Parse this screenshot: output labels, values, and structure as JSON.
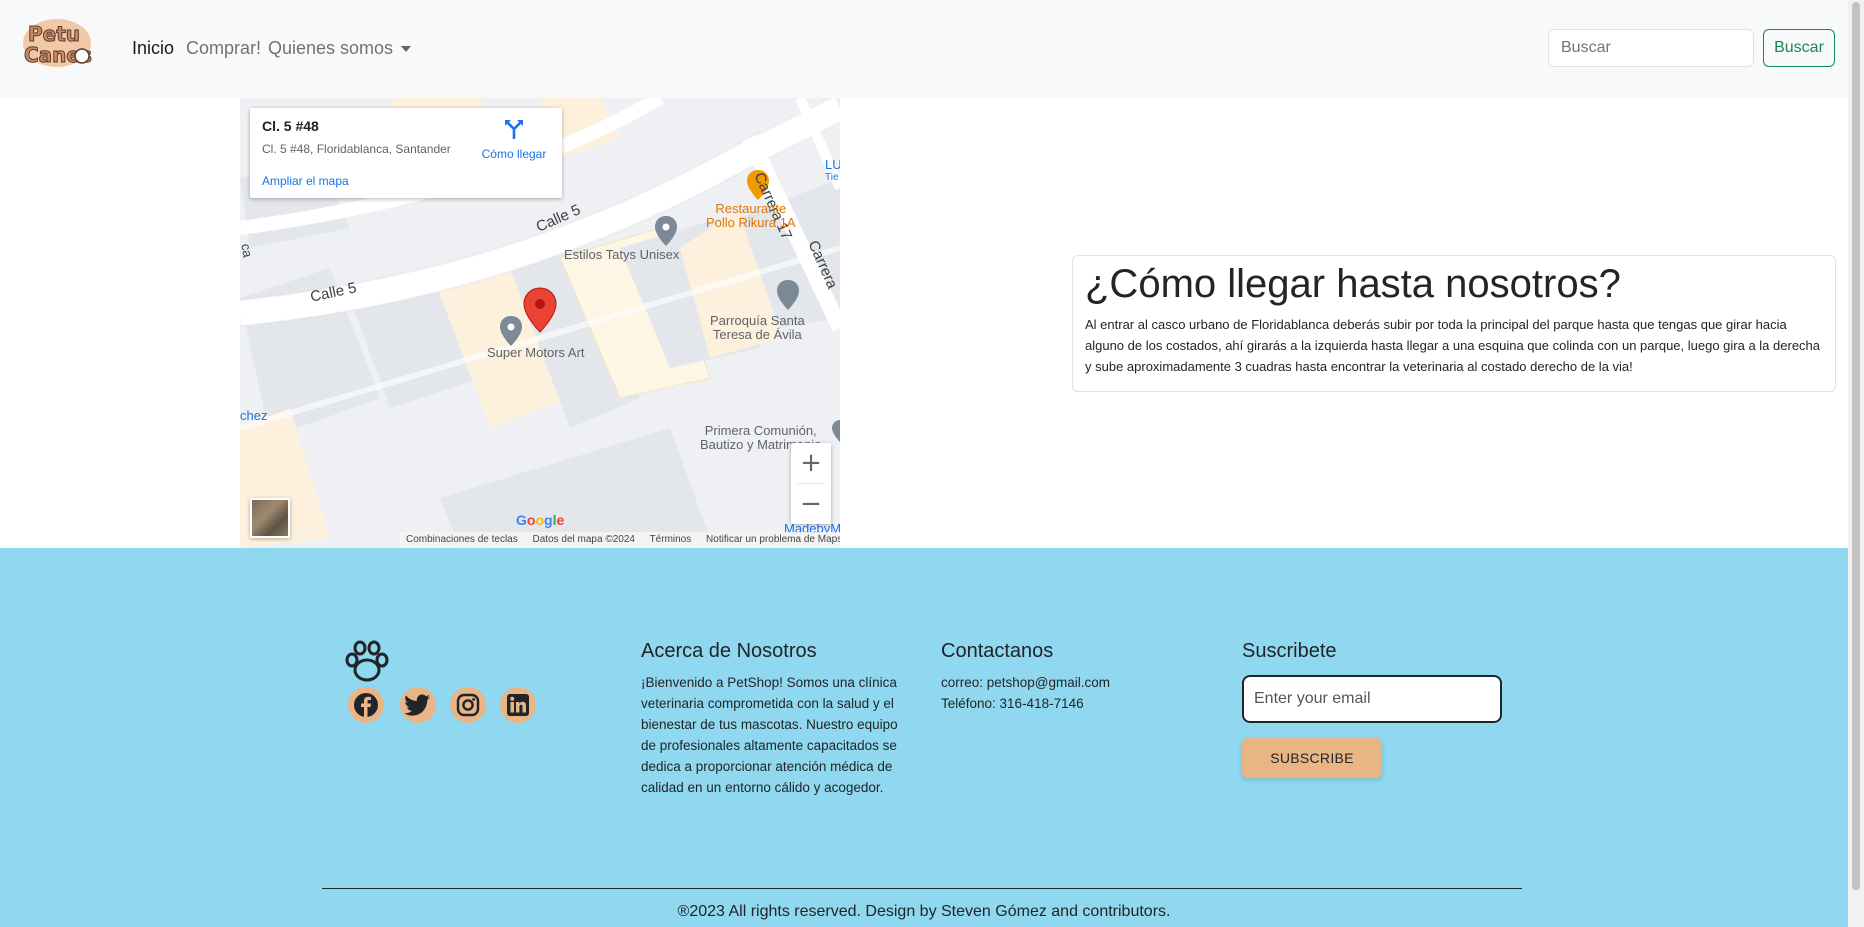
{
  "navbar": {
    "logo_alt": "PetuCanes",
    "links": [
      {
        "label": "Inicio",
        "active": true
      },
      {
        "label": "Comprar!",
        "active": false
      },
      {
        "label": "Quienes somos",
        "active": false
      }
    ],
    "search_placeholder": "Buscar",
    "search_button": "Buscar"
  },
  "map": {
    "card_title": "Cl. 5 #48",
    "card_address": "Cl. 5 #48, Floridablanca, Santander",
    "directions_label": "Cómo llegar",
    "enlarge_label": "Ampliar el mapa",
    "streets": [
      "Calle 5",
      "Calle 5",
      "Carrera 17",
      "Carrera",
      "ca",
      "chez"
    ],
    "pois": {
      "restaurant": "Restaurante\nPollo Rikura 1A",
      "salon": "Estilos Tatys Unisex",
      "church": "Parroquía Santa\nTeresa de Ávila",
      "motors": "Super Motors Art",
      "primera": "Primera Comunión,\nBautizo y Matrimonio",
      "lu": "LU",
      "tie": "Tie",
      "madeby": "MadebyM"
    },
    "zoom_in": "+",
    "zoom_out": "−",
    "google": "Google",
    "footer_links": [
      "Combinaciones de teclas",
      "Datos del mapa ©2024",
      "Términos",
      "Notificar un problema de Maps"
    ]
  },
  "info": {
    "title": "¿Cómo llegar hasta nosotros?",
    "text": "Al entrar al casco urbano de Floridablanca deberás subir por toda la principal del parque hasta que tengas que girar hacia alguno de los costados, ahí girarás a la izquierda hasta llegar a una esquina que colinda con un parque, luego gira a la derecha y sube aproximadamente 3 cuadras hasta encontrar la veterinaria al costado derecho de la via!"
  },
  "footer": {
    "social": [
      "facebook-icon",
      "twitter-icon",
      "instagram-icon",
      "linkedin-icon"
    ],
    "about_title": "Acerca de Nosotros",
    "about_text": "¡Bienvenido a PetShop! Somos una clínica veterinaria comprometida con la salud y el bienestar de tus mascotas. Nuestro equipo de profesionales altamente capacitados se dedica a proporcionar atención médica de calidad en un entorno cálido y acogedor.",
    "contact_title": "Contactanos",
    "contact_email": "correo: petshop@gmail.com",
    "contact_phone": "Teléfono: 316-418-7146",
    "subscribe_title": "Suscribete",
    "email_placeholder": "Enter your email",
    "subscribe_button": "SUBSCRIBE",
    "copyright": "®2023 All rights reserved. Design by Steven Gómez and contributors."
  },
  "colors": {
    "footer_bg": "#8fd8ef",
    "accent": "#e9b585",
    "search_green": "#198754"
  }
}
